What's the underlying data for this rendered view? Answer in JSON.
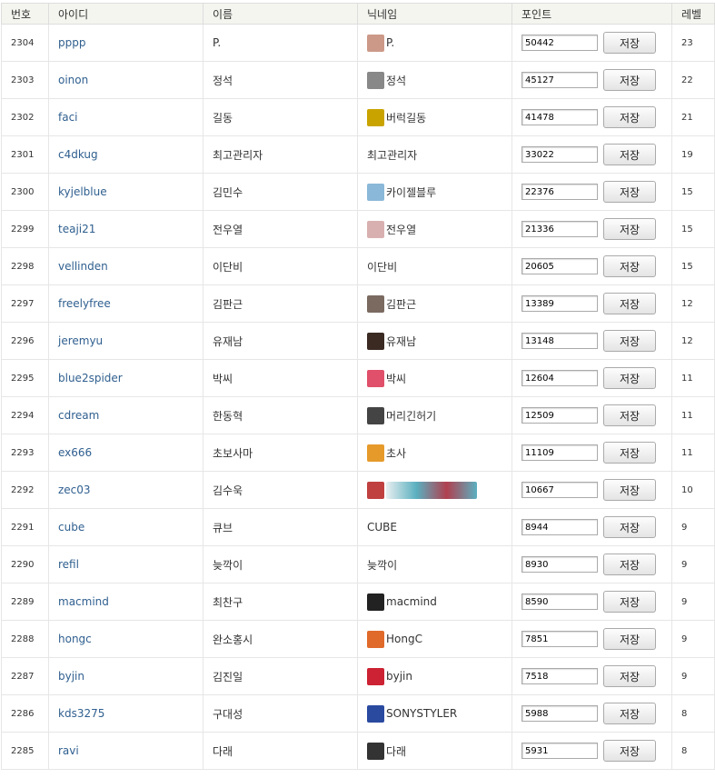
{
  "headers": {
    "no": "번호",
    "id": "아이디",
    "name": "이름",
    "nickname": "닉네임",
    "point": "포인트",
    "level": "레벨"
  },
  "save_label": "저장",
  "rows": [
    {
      "no": "2304",
      "id": "pppp",
      "name": "P.",
      "nick": "P.",
      "avatar": "#c98",
      "point": "50442",
      "level": "23"
    },
    {
      "no": "2303",
      "id": "oinon",
      "name": "정석",
      "nick": "정석",
      "avatar": "#888",
      "point": "45127",
      "level": "22"
    },
    {
      "no": "2302",
      "id": "faci",
      "name": "길동",
      "nick": "버럭길동",
      "avatar": "#c9a400",
      "point": "41478",
      "level": "21"
    },
    {
      "no": "2301",
      "id": "c4dkug",
      "name": "최고관리자",
      "nick": "최고관리자",
      "avatar": "",
      "point": "33022",
      "level": "19"
    },
    {
      "no": "2300",
      "id": "kyjelblue",
      "name": "김민수",
      "nick": "카이젤블루",
      "avatar": "#8ab8d8",
      "point": "22376",
      "level": "15"
    },
    {
      "no": "2299",
      "id": "teaji21",
      "name": "전우열",
      "nick": "전우열",
      "avatar": "#d9b0b0",
      "point": "21336",
      "level": "15"
    },
    {
      "no": "2298",
      "id": "vellinden",
      "name": "이단비",
      "nick": "이단비",
      "avatar": "",
      "point": "20605",
      "level": "15"
    },
    {
      "no": "2297",
      "id": "freelyfree",
      "name": "김판근",
      "nick": "김판근",
      "avatar": "#7a6a60",
      "point": "13389",
      "level": "12"
    },
    {
      "no": "2296",
      "id": "jeremyu",
      "name": "유재남",
      "nick": "유재남",
      "avatar": "#3a2a22",
      "point": "13148",
      "level": "12"
    },
    {
      "no": "2295",
      "id": "blue2spider",
      "name": "박씨",
      "nick": "박씨",
      "avatar": "#e0506a",
      "point": "12604",
      "level": "11"
    },
    {
      "no": "2294",
      "id": "cdream",
      "name": "한동혁",
      "nick": "머리긴허기",
      "avatar": "#444",
      "point": "12509",
      "level": "11"
    },
    {
      "no": "2293",
      "id": "ex666",
      "name": "초보사마",
      "nick": "초사",
      "avatar": "#e69a2a",
      "point": "11109",
      "level": "11"
    },
    {
      "no": "2292",
      "id": "zec03",
      "name": "김수욱",
      "nick": "",
      "avatar": "#c04040",
      "avatar_wide": "#5ab0c0",
      "point": "10667",
      "level": "10"
    },
    {
      "no": "2291",
      "id": "cube",
      "name": "큐브",
      "nick": "CUBE",
      "avatar": "",
      "point": "8944",
      "level": "9"
    },
    {
      "no": "2290",
      "id": "refil",
      "name": "늦깍이",
      "nick": "늦깍이",
      "avatar": "",
      "point": "8930",
      "level": "9"
    },
    {
      "no": "2289",
      "id": "macmind",
      "name": "최찬구",
      "nick": "macmind",
      "avatar": "#222",
      "point": "8590",
      "level": "9"
    },
    {
      "no": "2288",
      "id": "hongc",
      "name": "완소홍시",
      "nick": "HongC",
      "avatar": "#e06a2a",
      "point": "7851",
      "level": "9"
    },
    {
      "no": "2287",
      "id": "byjin",
      "name": "김진일",
      "nick": "byjin",
      "avatar": "#c23",
      "point": "7518",
      "level": "9"
    },
    {
      "no": "2286",
      "id": "kds3275",
      "name": "구대성",
      "nick": "SONYSTYLER",
      "avatar": "#2a4aa0",
      "point": "5988",
      "level": "8"
    },
    {
      "no": "2285",
      "id": "ravi",
      "name": "다래",
      "nick": "다래",
      "avatar": "#333",
      "point": "5931",
      "level": "8"
    }
  ]
}
